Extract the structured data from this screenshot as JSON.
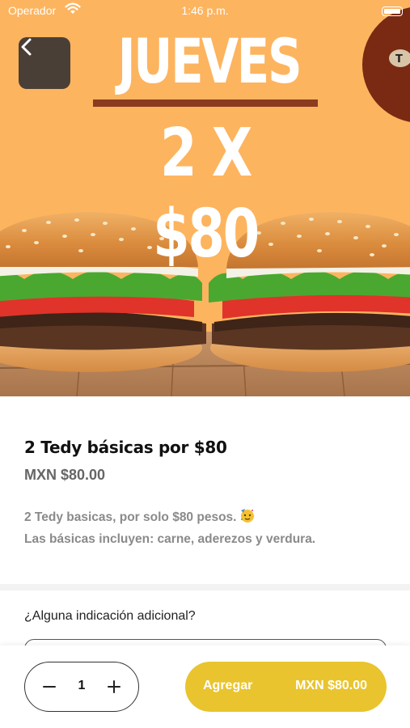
{
  "status_bar": {
    "carrier": "Operador",
    "time": "1:46 p.m."
  },
  "hero": {
    "promo_day": "JUEVES",
    "promo_offer": "2 X $80",
    "background_color": "#fdb45f",
    "rule_color": "#8b3b1e"
  },
  "product": {
    "title": "2 Tedy básicas por $80",
    "price": "MXN $80.00",
    "description_line1": "2 Tedy basicas, por solo $80 pesos.",
    "description_line2": "Las básicas incluyen: carne, aderezos y verdura."
  },
  "notes": {
    "label": "¿Alguna indicación adicional?",
    "placeholder": ""
  },
  "order": {
    "quantity": "1",
    "add_label": "Agregar",
    "add_price": "MXN $80.00",
    "accent_color": "#e9c42e"
  },
  "icons": {
    "back": "chevron-left-icon",
    "wifi": "wifi-icon",
    "battery": "battery-icon",
    "minus": "minus-icon",
    "plus": "plus-icon",
    "emoji": "partying-face-emoji-icon"
  }
}
